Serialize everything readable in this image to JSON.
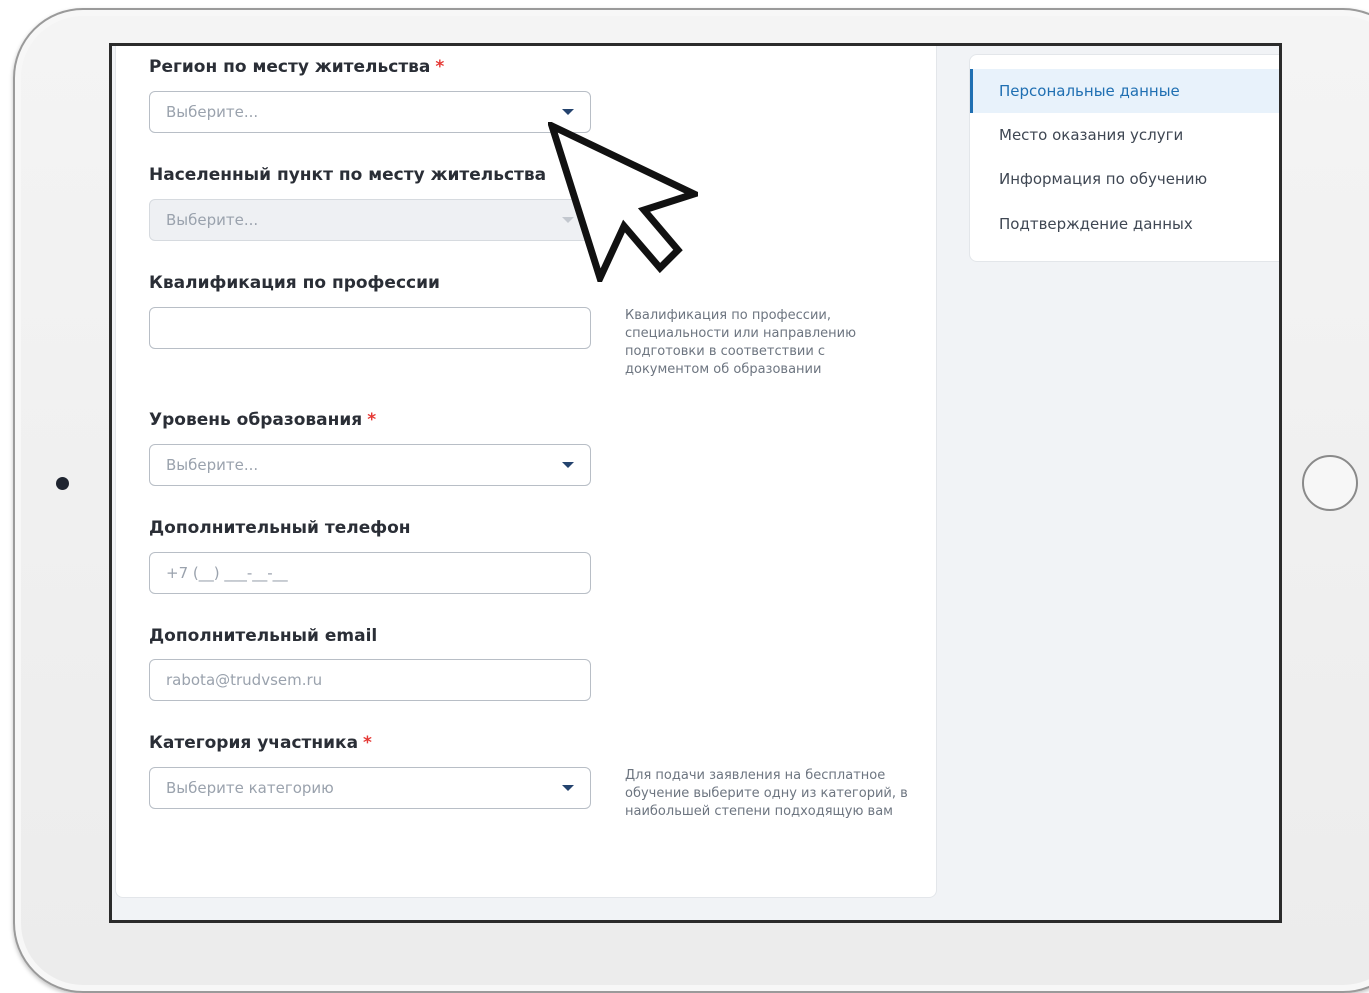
{
  "form": {
    "region": {
      "label": "Регион по месту жительства",
      "required_mark": "*",
      "placeholder": "Выберите..."
    },
    "locality": {
      "label": "Населенный пункт по месту жительства",
      "placeholder": "Выберите..."
    },
    "qualification": {
      "label": "Квалификация по профессии",
      "value": "",
      "hint": "Квалификация по профессии, специальности или направлению подготовки в соответствии с документом об образовании"
    },
    "education_level": {
      "label": "Уровень образования",
      "required_mark": "*",
      "placeholder": "Выберите..."
    },
    "extra_phone": {
      "label": "Дополнительный телефон",
      "placeholder": "+7 (__) ___-__-__"
    },
    "extra_email": {
      "label": "Дополнительный email",
      "placeholder": "rabota@trudvsem.ru"
    },
    "participant_category": {
      "label": "Категория участника",
      "required_mark": "*",
      "placeholder": "Выберите категорию",
      "hint": "Для подачи заявления на бесплатное обучение выберите одну из категорий, в наибольшей степени подходящую вам"
    }
  },
  "sidebar": {
    "items": [
      {
        "label": "Персональные данные",
        "active": true
      },
      {
        "label": "Место оказания услуги",
        "active": false
      },
      {
        "label": "Информация по обучению",
        "active": false
      },
      {
        "label": "Подтверждение данных",
        "active": false
      }
    ]
  },
  "colors": {
    "accent": "#1f6fb2",
    "required": "#e53935",
    "caret": "#24436e"
  }
}
